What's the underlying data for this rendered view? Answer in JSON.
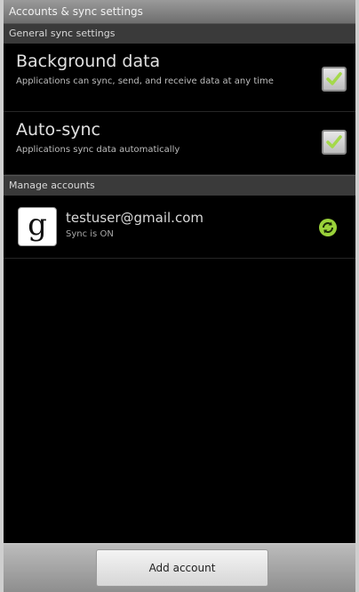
{
  "window": {
    "title": "Accounts & sync settings"
  },
  "general_sync": {
    "header": "General sync settings",
    "background_data": {
      "title": "Background data",
      "summary": "Applications can sync, send, and receive data at any time",
      "checked": true
    },
    "auto_sync": {
      "title": "Auto-sync",
      "summary": "Applications sync data automatically",
      "checked": true
    }
  },
  "manage_accounts": {
    "header": "Manage accounts",
    "accounts": [
      {
        "logo_letter": "g",
        "email": "testuser@gmail.com",
        "status": "Sync is ON",
        "sync_icon": "sync-on-icon"
      }
    ]
  },
  "footer": {
    "add_account_label": "Add account"
  },
  "colors": {
    "checkmark": "#a4d94a",
    "sync_icon": "#9ad23a",
    "background": "#000000",
    "section_header": "#3a3a3a"
  }
}
